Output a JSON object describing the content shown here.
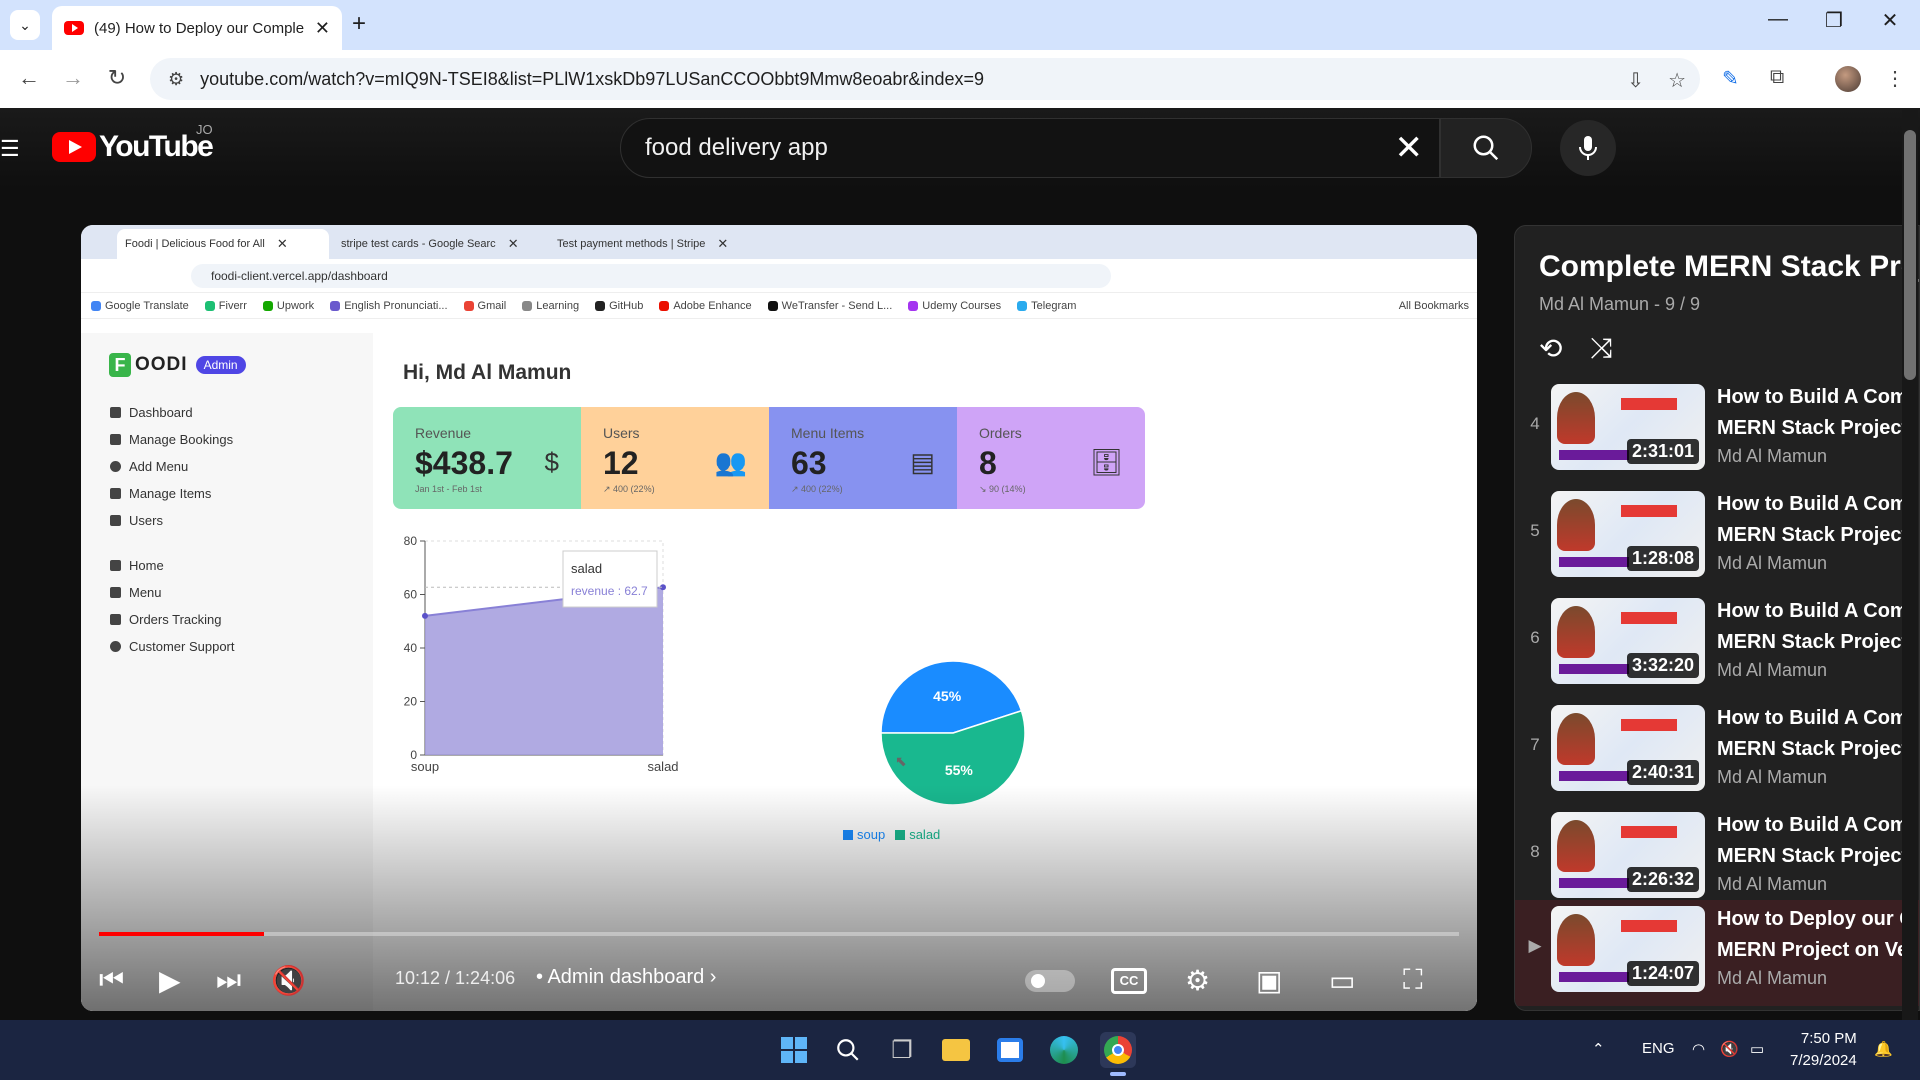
{
  "browser": {
    "tab_title": "(49) How to Deploy our Comple",
    "url": "youtube.com/watch?v=mIQ9N-TSEI8&list=PLlW1xskDb97LUSanCCOObbt9Mmw8eoabr&index=9"
  },
  "youtube": {
    "logo_text": "YouTube",
    "country_code": "JO",
    "search_query": "food delivery app"
  },
  "video_frame": {
    "tabs": [
      {
        "label": "Foodi | Delicious Food for All"
      },
      {
        "label": "stripe test cards - Google Searc"
      },
      {
        "label": "Test payment methods | Stripe"
      }
    ],
    "url": "foodi-client.vercel.app/dashboard",
    "bookmarks": [
      {
        "label": "Google Translate",
        "color": "#4285f4"
      },
      {
        "label": "Fiverr",
        "color": "#1dbf73"
      },
      {
        "label": "Upwork",
        "color": "#14a800"
      },
      {
        "label": "English Pronunciati...",
        "color": "#6a5acd"
      },
      {
        "label": "Gmail",
        "color": "#ea4335"
      },
      {
        "label": "Learning",
        "color": "#888888"
      },
      {
        "label": "GitHub",
        "color": "#222222"
      },
      {
        "label": "Adobe Enhance",
        "color": "#eb1000"
      },
      {
        "label": "WeTransfer - Send L...",
        "color": "#111111"
      },
      {
        "label": "Udemy Courses",
        "color": "#a435f0"
      },
      {
        "label": "Telegram",
        "color": "#2aabee"
      }
    ],
    "all_bookmarks": "All Bookmarks",
    "app": {
      "logo": "OODI",
      "logo_f": "F",
      "badge": "Admin",
      "menu": [
        {
          "label": "Dashboard"
        },
        {
          "label": "Manage Bookings"
        },
        {
          "label": "Add Menu"
        },
        {
          "label": "Manage Items"
        },
        {
          "label": "Users"
        },
        {
          "label": "Home"
        },
        {
          "label": "Menu"
        },
        {
          "label": "Orders Tracking"
        },
        {
          "label": "Customer Support"
        }
      ],
      "greeting": "Hi, Md Al Mamun",
      "stats": [
        {
          "title": "Revenue",
          "value": "$438.7",
          "desc": "Jan 1st - Feb 1st",
          "color": "#8fe3b8",
          "icon": "$"
        },
        {
          "title": "Users",
          "value": "12",
          "desc": "↗ 400 (22%)",
          "color": "#ffd19a",
          "icon": "👥"
        },
        {
          "title": "Menu Items",
          "value": "63",
          "desc": "↗ 400 (22%)",
          "color": "#8792f0",
          "icon": "▤"
        },
        {
          "title": "Orders",
          "value": "8",
          "desc": "↘ 90 (14%)",
          "color": "#cfa4f7",
          "icon": "🗄"
        }
      ]
    },
    "chart_data": [
      {
        "type": "area",
        "x": [
          "soup",
          "salad"
        ],
        "series": [
          {
            "name": "revenue",
            "values": [
              52,
              62.7
            ]
          }
        ],
        "ylim": [
          0,
          80
        ],
        "yticks": [
          0,
          20,
          40,
          60,
          80
        ],
        "tooltip": {
          "title": "salad",
          "text": "revenue : 62.7"
        },
        "color": "#a29bdd"
      },
      {
        "type": "pie",
        "categories": [
          "soup",
          "salad"
        ],
        "values": [
          45,
          55
        ],
        "labels": [
          "45%",
          "55%"
        ],
        "colors": [
          "#1a8cff",
          "#19b88f"
        ],
        "legend": [
          "soup",
          "salad"
        ]
      }
    ]
  },
  "player": {
    "time": "10:12 / 1:24:06",
    "chapter": "• Admin dashboard",
    "progress": 0.121
  },
  "playlist": {
    "title": "Complete MERN Stack Projects",
    "subtitle": "Md Al Mamun - 9 / 9",
    "items": [
      {
        "index": "4",
        "title": "How to Build A Complete",
        "title2": "MERN Stack Projects",
        "author": "Md Al Mamun",
        "duration": "2:31:01"
      },
      {
        "index": "5",
        "title": "How to Build A Complete",
        "title2": "MERN Stack Projects",
        "author": "Md Al Mamun",
        "duration": "1:28:08"
      },
      {
        "index": "6",
        "title": "How to Build A Complete",
        "title2": "MERN Stack Projects",
        "author": "Md Al Mamun",
        "duration": "3:32:20"
      },
      {
        "index": "7",
        "title": "How to Build A Complete",
        "title2": "MERN Stack Projects",
        "author": "Md Al Mamun",
        "duration": "2:40:31"
      },
      {
        "index": "8",
        "title": "How to Build A Complete",
        "title2": "MERN Stack Projects",
        "author": "Md Al Mamun",
        "duration": "2:26:32"
      },
      {
        "index": "▶",
        "title": "How to Deploy our Complete",
        "title2": "MERN Project on Vercel",
        "author": "Md Al Mamun",
        "duration": "1:24:07"
      }
    ]
  },
  "taskbar": {
    "lang": "ENG",
    "time": "7:50 PM",
    "date": "7/29/2024"
  }
}
